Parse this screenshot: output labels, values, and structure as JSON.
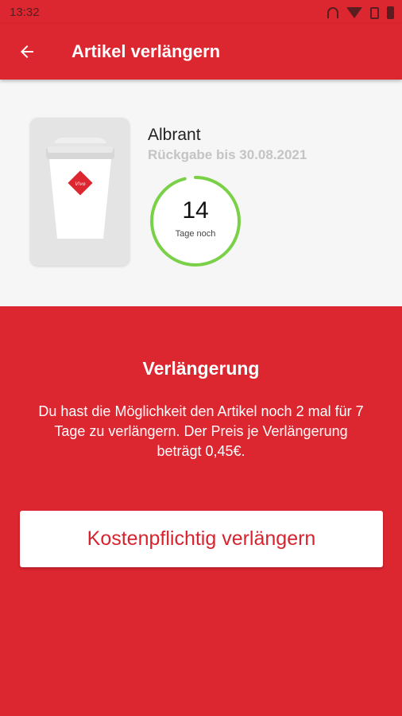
{
  "status_bar": {
    "time": "13:32",
    "icons": [
      "headset-icon",
      "wifi-icon",
      "sim-icon",
      "battery-icon"
    ]
  },
  "app_bar": {
    "back_icon": "arrow-left-icon",
    "title": "Artikel verlängern"
  },
  "item": {
    "name": "Albrant",
    "return_date": "Rückgabe bis 30.08.2021",
    "image_icon": "coffee-cup-icon",
    "days_left": "14",
    "days_label": "Tage noch",
    "progress_fraction": 0.96,
    "progress_color": "#7ad148"
  },
  "extension": {
    "title": "Verlängerung",
    "description": "Du hast die Möglichkeit den Artikel noch 2 mal für 7 Tage zu verlängern. Der Preis je Verlängerung beträgt 0,45€.",
    "button_label": "Kostenpflichtig verlängern"
  },
  "colors": {
    "brand_red": "#dc2630",
    "card_background": "#f6f6f6",
    "button_text": "#d8232f"
  }
}
